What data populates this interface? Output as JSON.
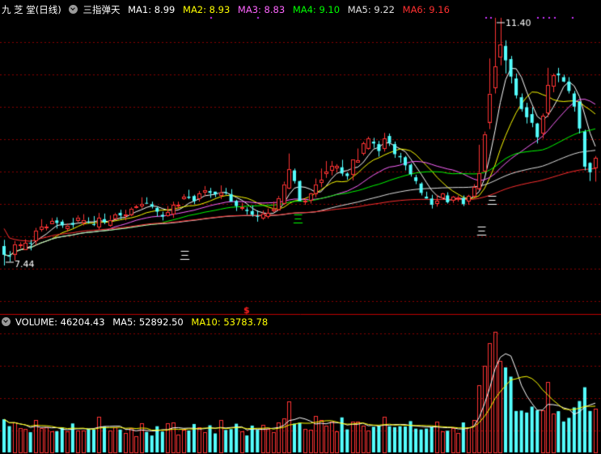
{
  "header": {
    "title": "九 芝 堂(日线)",
    "indicator_name": "三指弹天",
    "ma": [
      {
        "label": "MA1: 8.99",
        "color": "#ffffff"
      },
      {
        "label": "MA2: 8.93",
        "color": "#ffff00"
      },
      {
        "label": "MA3: 8.83",
        "color": "#ff66ff"
      },
      {
        "label": "MA4: 9.10",
        "color": "#00ff00"
      },
      {
        "label": "MA5: 9.22",
        "color": "#e0e0e0"
      },
      {
        "label": "MA6: 9.16",
        "color": "#ff3030"
      }
    ]
  },
  "annotations": {
    "high_label": "11.40",
    "low_label": "7.44",
    "signal_mark": "三",
    "divider_mark": "$"
  },
  "volume_panel": {
    "volume_label": "VOLUME: 46204.43",
    "ma5_label": "MA5: 52892.50",
    "ma10_label": "MA10: 53783.78"
  },
  "colors": {
    "up": "#ff3333",
    "down": "#54ffff",
    "background": "#000000",
    "grid": "#8b0000",
    "divider": "#c00000"
  },
  "chart_data": {
    "type": "candlestick",
    "price_range": [
      7.44,
      11.4
    ],
    "candles": [
      [
        7.75,
        7.61,
        7.85,
        7.44
      ],
      [
        7.6,
        7.58,
        7.67,
        7.5
      ],
      [
        7.63,
        7.78,
        7.83,
        7.52
      ],
      [
        7.78,
        7.78,
        7.81,
        7.71
      ],
      [
        7.7,
        7.8,
        7.86,
        7.7
      ],
      [
        7.8,
        7.79,
        7.85,
        7.68
      ],
      [
        7.84,
        8.0,
        8.04,
        7.77
      ],
      [
        8.02,
        8.06,
        8.18,
        7.98
      ],
      [
        8.06,
        8.06,
        8.1,
        8.0
      ],
      [
        8.11,
        8.15,
        8.2,
        8.1
      ],
      [
        8.16,
        8.12,
        8.21,
        8.03
      ],
      [
        8.14,
        8.08,
        8.17,
        8.04
      ],
      [
        8.04,
        8.08,
        8.11,
        7.98
      ],
      [
        8.12,
        8.09,
        8.2,
        8.04
      ],
      [
        8.17,
        8.21,
        8.24,
        8.13
      ],
      [
        8.13,
        8.17,
        8.26,
        8.08
      ],
      [
        8.14,
        8.13,
        8.21,
        8.11
      ],
      [
        8.1,
        8.09,
        8.23,
        8.07
      ],
      [
        8.06,
        8.2,
        8.28,
        8.01
      ],
      [
        8.18,
        8.13,
        8.27,
        8.1
      ],
      [
        8.09,
        8.17,
        8.24,
        8.06
      ],
      [
        8.2,
        8.26,
        8.28,
        8.17
      ],
      [
        8.28,
        8.24,
        8.33,
        8.18
      ],
      [
        8.25,
        8.26,
        8.33,
        8.16
      ],
      [
        8.26,
        8.35,
        8.37,
        8.23
      ],
      [
        8.37,
        8.38,
        8.41,
        8.35
      ],
      [
        8.39,
        8.42,
        8.53,
        8.35
      ],
      [
        8.44,
        8.43,
        8.53,
        8.43
      ],
      [
        8.42,
        8.38,
        8.46,
        8.35
      ],
      [
        8.36,
        8.3,
        8.38,
        8.22
      ],
      [
        8.25,
        8.22,
        8.3,
        8.16
      ],
      [
        8.24,
        8.29,
        8.39,
        8.22
      ],
      [
        8.27,
        8.41,
        8.46,
        8.2
      ],
      [
        8.4,
        8.41,
        8.46,
        8.34
      ],
      [
        8.51,
        8.54,
        8.58,
        8.49
      ],
      [
        8.54,
        8.52,
        8.65,
        8.5
      ],
      [
        8.55,
        8.47,
        8.57,
        8.42
      ],
      [
        8.51,
        8.59,
        8.63,
        8.46
      ],
      [
        8.62,
        8.65,
        8.71,
        8.55
      ],
      [
        8.63,
        8.6,
        8.68,
        8.52
      ],
      [
        8.62,
        8.58,
        8.62,
        8.53
      ],
      [
        8.57,
        8.61,
        8.72,
        8.5
      ],
      [
        8.61,
        8.6,
        8.68,
        8.57
      ],
      [
        8.58,
        8.46,
        8.66,
        8.46
      ],
      [
        8.47,
        8.39,
        8.49,
        8.31
      ],
      [
        8.37,
        8.37,
        8.44,
        8.32
      ],
      [
        8.33,
        8.31,
        8.37,
        8.25
      ],
      [
        8.31,
        8.25,
        8.4,
        8.22
      ],
      [
        8.23,
        8.22,
        8.32,
        8.14
      ],
      [
        8.2,
        8.27,
        8.32,
        8.17
      ],
      [
        8.23,
        8.28,
        8.35,
        8.19
      ],
      [
        8.33,
        8.35,
        8.46,
        8.29
      ],
      [
        8.34,
        8.52,
        8.55,
        8.32
      ],
      [
        8.44,
        8.74,
        8.78,
        8.41
      ],
      [
        8.68,
        8.98,
        9.23,
        8.66
      ],
      [
        8.96,
        8.79,
        8.99,
        8.75
      ],
      [
        8.79,
        8.47,
        8.8,
        8.47
      ],
      [
        8.46,
        8.47,
        8.52,
        8.41
      ],
      [
        8.48,
        8.59,
        8.6,
        8.43
      ],
      [
        8.6,
        8.74,
        8.83,
        8.53
      ],
      [
        8.77,
        8.81,
        8.99,
        8.69
      ],
      [
        8.91,
        8.94,
        9.11,
        8.84
      ],
      [
        8.96,
        9.03,
        9.11,
        8.88
      ],
      [
        9.0,
        9.03,
        9.06,
        8.93
      ],
      [
        9.01,
        8.91,
        9.13,
        8.87
      ],
      [
        8.91,
        8.87,
        8.93,
        8.81
      ],
      [
        8.9,
        9.13,
        9.13,
        8.8
      ],
      [
        9.09,
        9.12,
        9.31,
        9.09
      ],
      [
        9.23,
        9.39,
        9.42,
        9.2
      ],
      [
        9.32,
        9.47,
        9.5,
        9.29
      ],
      [
        9.42,
        9.39,
        9.48,
        9.32
      ],
      [
        9.38,
        9.27,
        9.43,
        9.18
      ],
      [
        9.31,
        9.47,
        9.56,
        9.26
      ],
      [
        9.51,
        9.4,
        9.55,
        9.35
      ],
      [
        9.38,
        9.22,
        9.42,
        9.16
      ],
      [
        9.19,
        9.17,
        9.24,
        9.08
      ],
      [
        9.17,
        9.04,
        9.19,
        8.96
      ],
      [
        9.05,
        8.9,
        9.07,
        8.86
      ],
      [
        8.85,
        8.79,
        8.89,
        8.74
      ],
      [
        8.75,
        8.6,
        8.77,
        8.56
      ],
      [
        8.54,
        8.51,
        8.62,
        8.51
      ],
      [
        8.51,
        8.41,
        8.57,
        8.35
      ],
      [
        8.43,
        8.47,
        8.57,
        8.38
      ],
      [
        8.52,
        8.59,
        8.6,
        8.5
      ],
      [
        8.56,
        8.45,
        8.61,
        8.43
      ],
      [
        8.49,
        8.54,
        8.55,
        8.44
      ],
      [
        8.53,
        8.53,
        8.56,
        8.46
      ],
      [
        8.52,
        8.42,
        8.56,
        8.39
      ],
      [
        8.47,
        8.55,
        8.57,
        8.41
      ],
      [
        8.55,
        8.69,
        8.74,
        8.52
      ],
      [
        8.68,
        8.92,
        9.37,
        8.65
      ],
      [
        8.96,
        9.54,
        9.58,
        8.93
      ],
      [
        9.74,
        10.19,
        10.75,
        9.62
      ],
      [
        10.29,
        10.62,
        11.4,
        10.19
      ],
      [
        10.77,
        10.97,
        11.4,
        10.64
      ],
      [
        10.95,
        10.72,
        11.04,
        10.51
      ],
      [
        10.74,
        10.46,
        10.79,
        10.35
      ],
      [
        10.43,
        10.16,
        10.51,
        10.11
      ],
      [
        10.13,
        9.94,
        10.19,
        9.9
      ],
      [
        9.97,
        9.81,
        10.04,
        9.71
      ],
      [
        9.86,
        9.72,
        9.97,
        9.65
      ],
      [
        9.71,
        9.49,
        9.72,
        9.39
      ],
      [
        9.56,
        9.83,
        9.87,
        9.47
      ],
      [
        9.88,
        10.32,
        10.6,
        9.81
      ],
      [
        10.31,
        10.48,
        10.51,
        10.21
      ],
      [
        10.51,
        10.48,
        10.6,
        10.37
      ],
      [
        10.45,
        10.38,
        10.49,
        10.37
      ],
      [
        10.38,
        10.23,
        10.45,
        10.19
      ],
      [
        10.19,
        9.98,
        10.23,
        9.9
      ],
      [
        10.06,
        9.63,
        10.07,
        9.55
      ],
      [
        9.58,
        9.02,
        9.61,
        8.96
      ],
      [
        9.08,
        8.93,
        9.09,
        8.79
      ],
      [
        9.01,
        9.16,
        9.19,
        8.78
      ]
    ]
  }
}
